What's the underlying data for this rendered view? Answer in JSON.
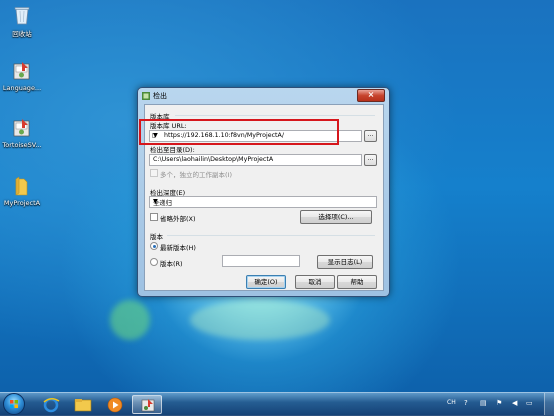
{
  "desktop": {
    "icons": [
      {
        "label": "回收站"
      },
      {
        "label": "Language..."
      },
      {
        "label": "TortoiseSV..."
      },
      {
        "label": "MyProjectA"
      }
    ]
  },
  "dialog": {
    "title": "检出",
    "close_label": "×",
    "repository_group": "版本库",
    "url_label": "版本库 URL:",
    "url_value": "https://192.168.1.10:f8vn/MyProjectA/",
    "browse_label": "...",
    "checkout_dir_label": "检出至目录(D):",
    "checkout_dir_value": "C:\\Users\\laohailin\\Desktop\\MyProjectA",
    "multi_label": "多个，独立的工作副本(I)",
    "depth_label": "检出深度(E)",
    "depth_value": "全递归",
    "omit_externals_label": "省略外部(X)",
    "choose_items_label": "选择项(C)...",
    "revision_group": "版本",
    "head_label": "最新版本(H)",
    "revision_label": "版本(R)",
    "show_log_label": "显示日志(L)",
    "ok_label": "确定(O)",
    "cancel_label": "取消",
    "help_label": "帮助"
  },
  "taskbar": {
    "apps": [
      "start",
      "internet-explorer",
      "file-explorer",
      "media-player",
      "tortoisesvn"
    ],
    "tray_text": "CH"
  },
  "colors": {
    "highlight": "#d6161c",
    "desktop": "#1580cc"
  }
}
